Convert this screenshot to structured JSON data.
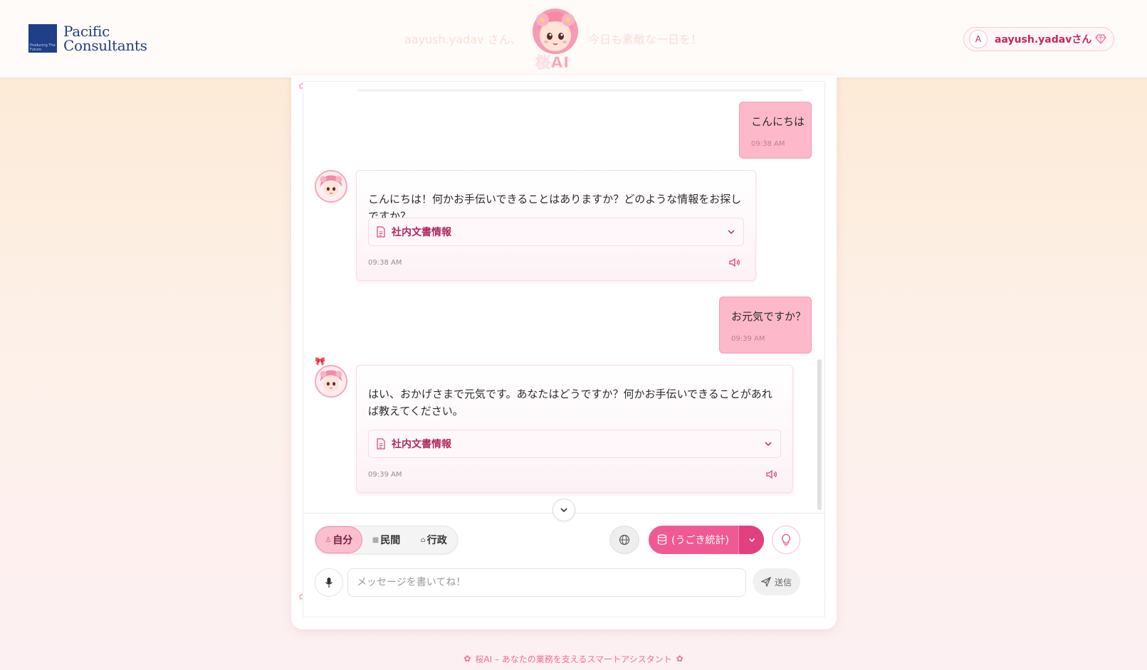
{
  "header": {
    "brand_line1": "Pacific",
    "brand_line2": "Consultants",
    "brand_tagline": "Producing The Future",
    "faded_left": "aayush.yadav さん、",
    "faded_right": "今日も素敵な一日を！",
    "mascot_label": "桜AI",
    "user_initial": "A",
    "user_name": "aayush.yadavさん"
  },
  "messages": [
    {
      "role": "user",
      "text": "こんにちは",
      "time": "09:38 AM"
    },
    {
      "role": "bot",
      "text": "こんにちは！何かお手伝いできることはありますか？どのような情報をお探しですか？",
      "doc_label": "社内文書情報",
      "time": "09:38 AM"
    },
    {
      "role": "user",
      "text": "お元気ですか？",
      "time": "09:39 AM"
    },
    {
      "role": "bot",
      "text": "はい、おかげさまで元気です。あなたはどうですか？何かお手伝いできることがあれば教えてください。",
      "doc_label": "社内文書情報",
      "time": "09:39 AM"
    }
  ],
  "modes": [
    {
      "label": "自分",
      "icon": "person-icon",
      "active": true
    },
    {
      "label": "民間",
      "icon": "building-icon",
      "active": false
    },
    {
      "label": "行政",
      "icon": "government-icon",
      "active": false
    }
  ],
  "database_button": {
    "label": "(うごき統計)",
    "icon": "database-icon"
  },
  "input": {
    "placeholder": "メッセージを書いてね！",
    "value": ""
  },
  "send_label": "送信",
  "footer": {
    "text": "桜AI – あなたの業務を支えるスマートアシスタント"
  },
  "colors": {
    "accent": "#ef5a94",
    "bubble_user": "#fdb9c9",
    "brand": "#1f3f86"
  }
}
